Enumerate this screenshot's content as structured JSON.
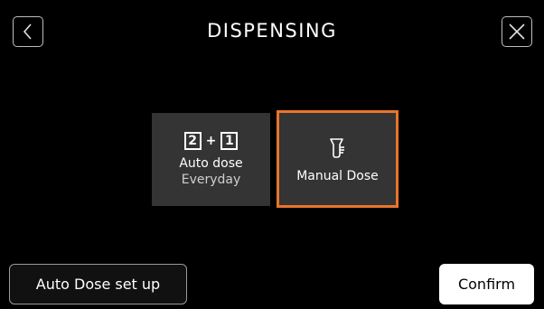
{
  "header": {
    "title": "DISPENSING",
    "back_icon": "chevron-left-icon",
    "close_icon": "close-icon"
  },
  "options": {
    "auto": {
      "icon": "dose-schedule-icon",
      "icon_left": "2",
      "icon_plus": "+",
      "icon_right": "1",
      "label": "Auto dose",
      "sublabel": "Everyday"
    },
    "manual": {
      "icon": "manual-dispense-icon",
      "label": "Manual Dose",
      "selected": true
    }
  },
  "footer": {
    "setup_label": "Auto Dose set up",
    "confirm_label": "Confirm"
  },
  "colors": {
    "background": "#000000",
    "tile": "#343434",
    "accent": "#e9742a"
  }
}
